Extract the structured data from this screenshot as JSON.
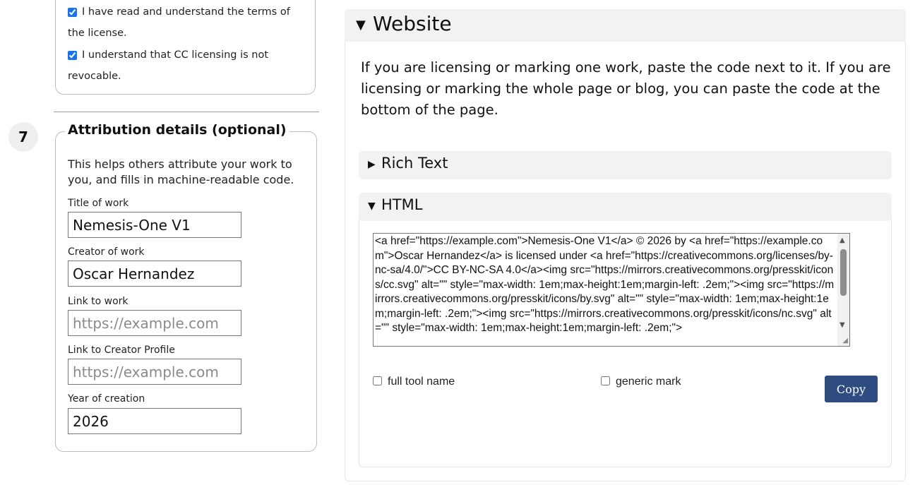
{
  "terms": {
    "read_label": "I have read and understand the terms of the license.",
    "revocable_label": "I understand that CC licensing is not revocable."
  },
  "attribution": {
    "step_number": "7",
    "legend": "Attribution details (optional)",
    "help": "This helps others attribute your work to you, and fills in machine-readable code.",
    "fields": {
      "title": {
        "label": "Title of work",
        "value": "Nemesis-One V1"
      },
      "creator": {
        "label": "Creator of work",
        "value": "Oscar Hernandez"
      },
      "link_work": {
        "label": "Link to work",
        "value": "",
        "placeholder": "https://example.com"
      },
      "link_creator": {
        "label": "Link to Creator Profile",
        "value": "",
        "placeholder": "https://example.com"
      },
      "year": {
        "label": "Year of creation",
        "value": "2026"
      }
    }
  },
  "website": {
    "title": "Website",
    "intro": "If you are licensing or marking one work, paste the code next to it. If you are licensing or marking the whole page or blog, you can paste the code at the bottom of the page.",
    "rich_text_label": "Rich Text",
    "html_label": "HTML",
    "code": "<a href=\"https://example.com\">Nemesis-One V1</a> © 2026 by <a href=\"https://example.com\">Oscar Hernandez</a> is licensed under <a href=\"https://creativecommons.org/licenses/by-nc-sa/4.0/\">CC BY-NC-SA 4.0</a><img src=\"https://mirrors.creativecommons.org/presskit/icons/cc.svg\" alt=\"\" style=\"max-width: 1em;max-height:1em;margin-left: .2em;\"><img src=\"https://mirrors.creativecommons.org/presskit/icons/by.svg\" alt=\"\" style=\"max-width: 1em;max-height:1em;margin-left: .2em;\"><img src=\"https://mirrors.creativecommons.org/presskit/icons/nc.svg\" alt=\"\" style=\"max-width: 1em;max-height:1em;margin-left: .2em;\">",
    "full_tool_name_label": "full tool name",
    "generic_mark_label": "generic mark",
    "copy_label": "Copy"
  }
}
